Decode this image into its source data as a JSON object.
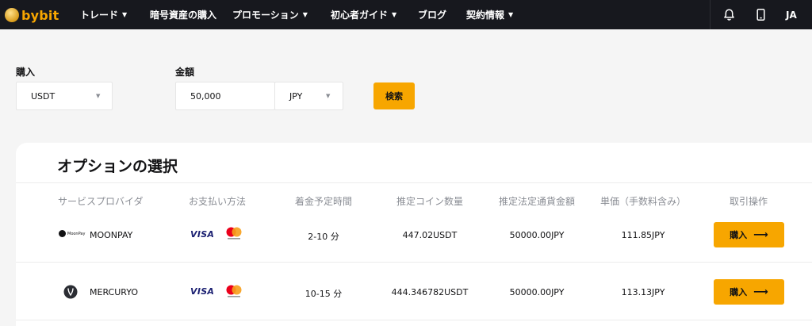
{
  "header": {
    "logo_text": "bybit",
    "nav": [
      {
        "label": "トレード",
        "dropdown": true
      },
      {
        "label": "暗号資産の購入",
        "dropdown": false
      },
      {
        "label": "プロモーション",
        "dropdown": true
      },
      {
        "label": "初心者ガイド",
        "dropdown": true
      },
      {
        "label": "ブログ",
        "dropdown": false
      },
      {
        "label": "契約情報",
        "dropdown": true
      }
    ],
    "icons": [
      "bell-icon",
      "mobile-icon"
    ],
    "lang": "JA"
  },
  "form": {
    "buy_label": "購入",
    "buy_value": "USDT",
    "amount_label": "金額",
    "amount_value": "50,000",
    "fiat_value": "JPY",
    "search_label": "検索"
  },
  "colors": {
    "accent": "#f7a600",
    "header_bg": "#17181e",
    "visa": "#1a1f71",
    "mc_red": "#eb001b",
    "mc_orange": "#f79e1b"
  },
  "options": {
    "title": "オプションの選択",
    "columns": [
      "サービスプロバイダ",
      "お支払い方法",
      "着金予定時間",
      "推定コイン数量",
      "推定法定通貨金額",
      "単価（手数料含み）",
      "取引操作"
    ],
    "rows": [
      {
        "provider": "MOONPAY",
        "provider_icon": "moonpay-logo-icon",
        "provider_logo_text": "MoonPay",
        "payment_visa": "VISA",
        "payment_mc": "mastercard",
        "time": "2-10 分",
        "coins": "447.02USDT",
        "fiat": "50000.00JPY",
        "price": "111.85JPY",
        "action": "購入"
      },
      {
        "provider": "MERCURYO",
        "provider_icon": "mercuryo-logo-icon",
        "provider_logo_text": "",
        "payment_visa": "VISA",
        "payment_mc": "mastercard",
        "time": "10-15 分",
        "coins": "444.346782USDT",
        "fiat": "50000.00JPY",
        "price": "113.13JPY",
        "action": "購入"
      }
    ]
  }
}
